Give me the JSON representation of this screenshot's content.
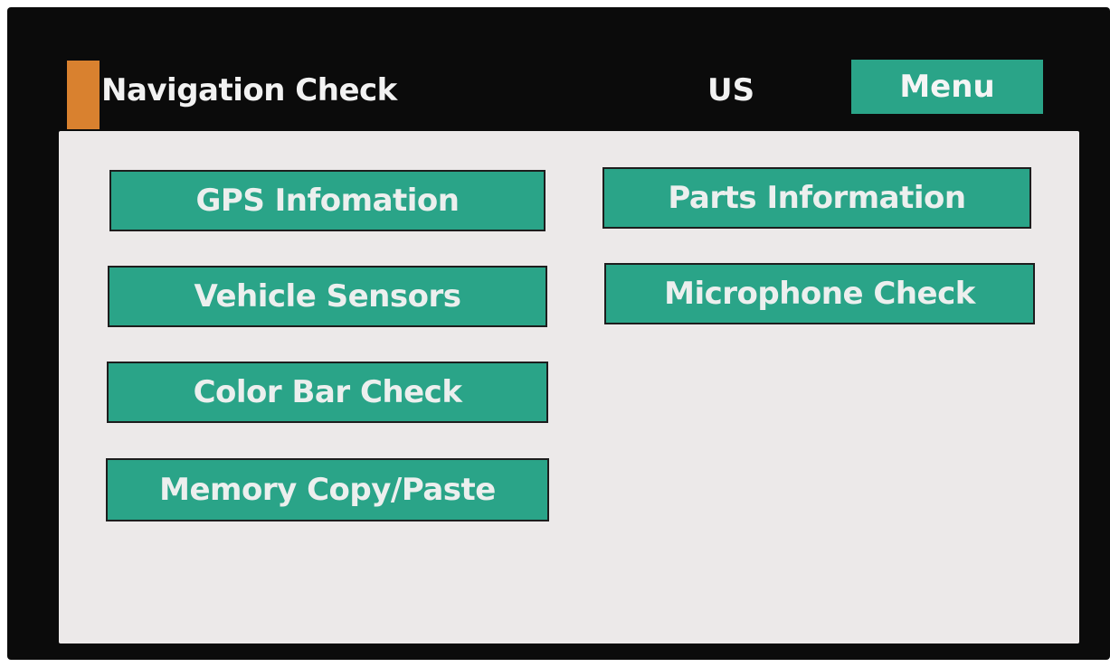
{
  "header": {
    "title": "Navigation Check",
    "region": "US",
    "menu_label": "Menu"
  },
  "buttons": {
    "gps_info": "GPS Infomation",
    "vehicle_sensors": "Vehicle Sensors",
    "color_bar_check": "Color Bar Check",
    "memory_copy_paste": "Memory Copy/Paste",
    "parts_info": "Parts Information",
    "microphone_check": "Microphone Check"
  },
  "colors": {
    "accent": "#d9812f",
    "button": "#2aa488",
    "panel": "#ece9e9",
    "background": "#0b0b0b"
  }
}
